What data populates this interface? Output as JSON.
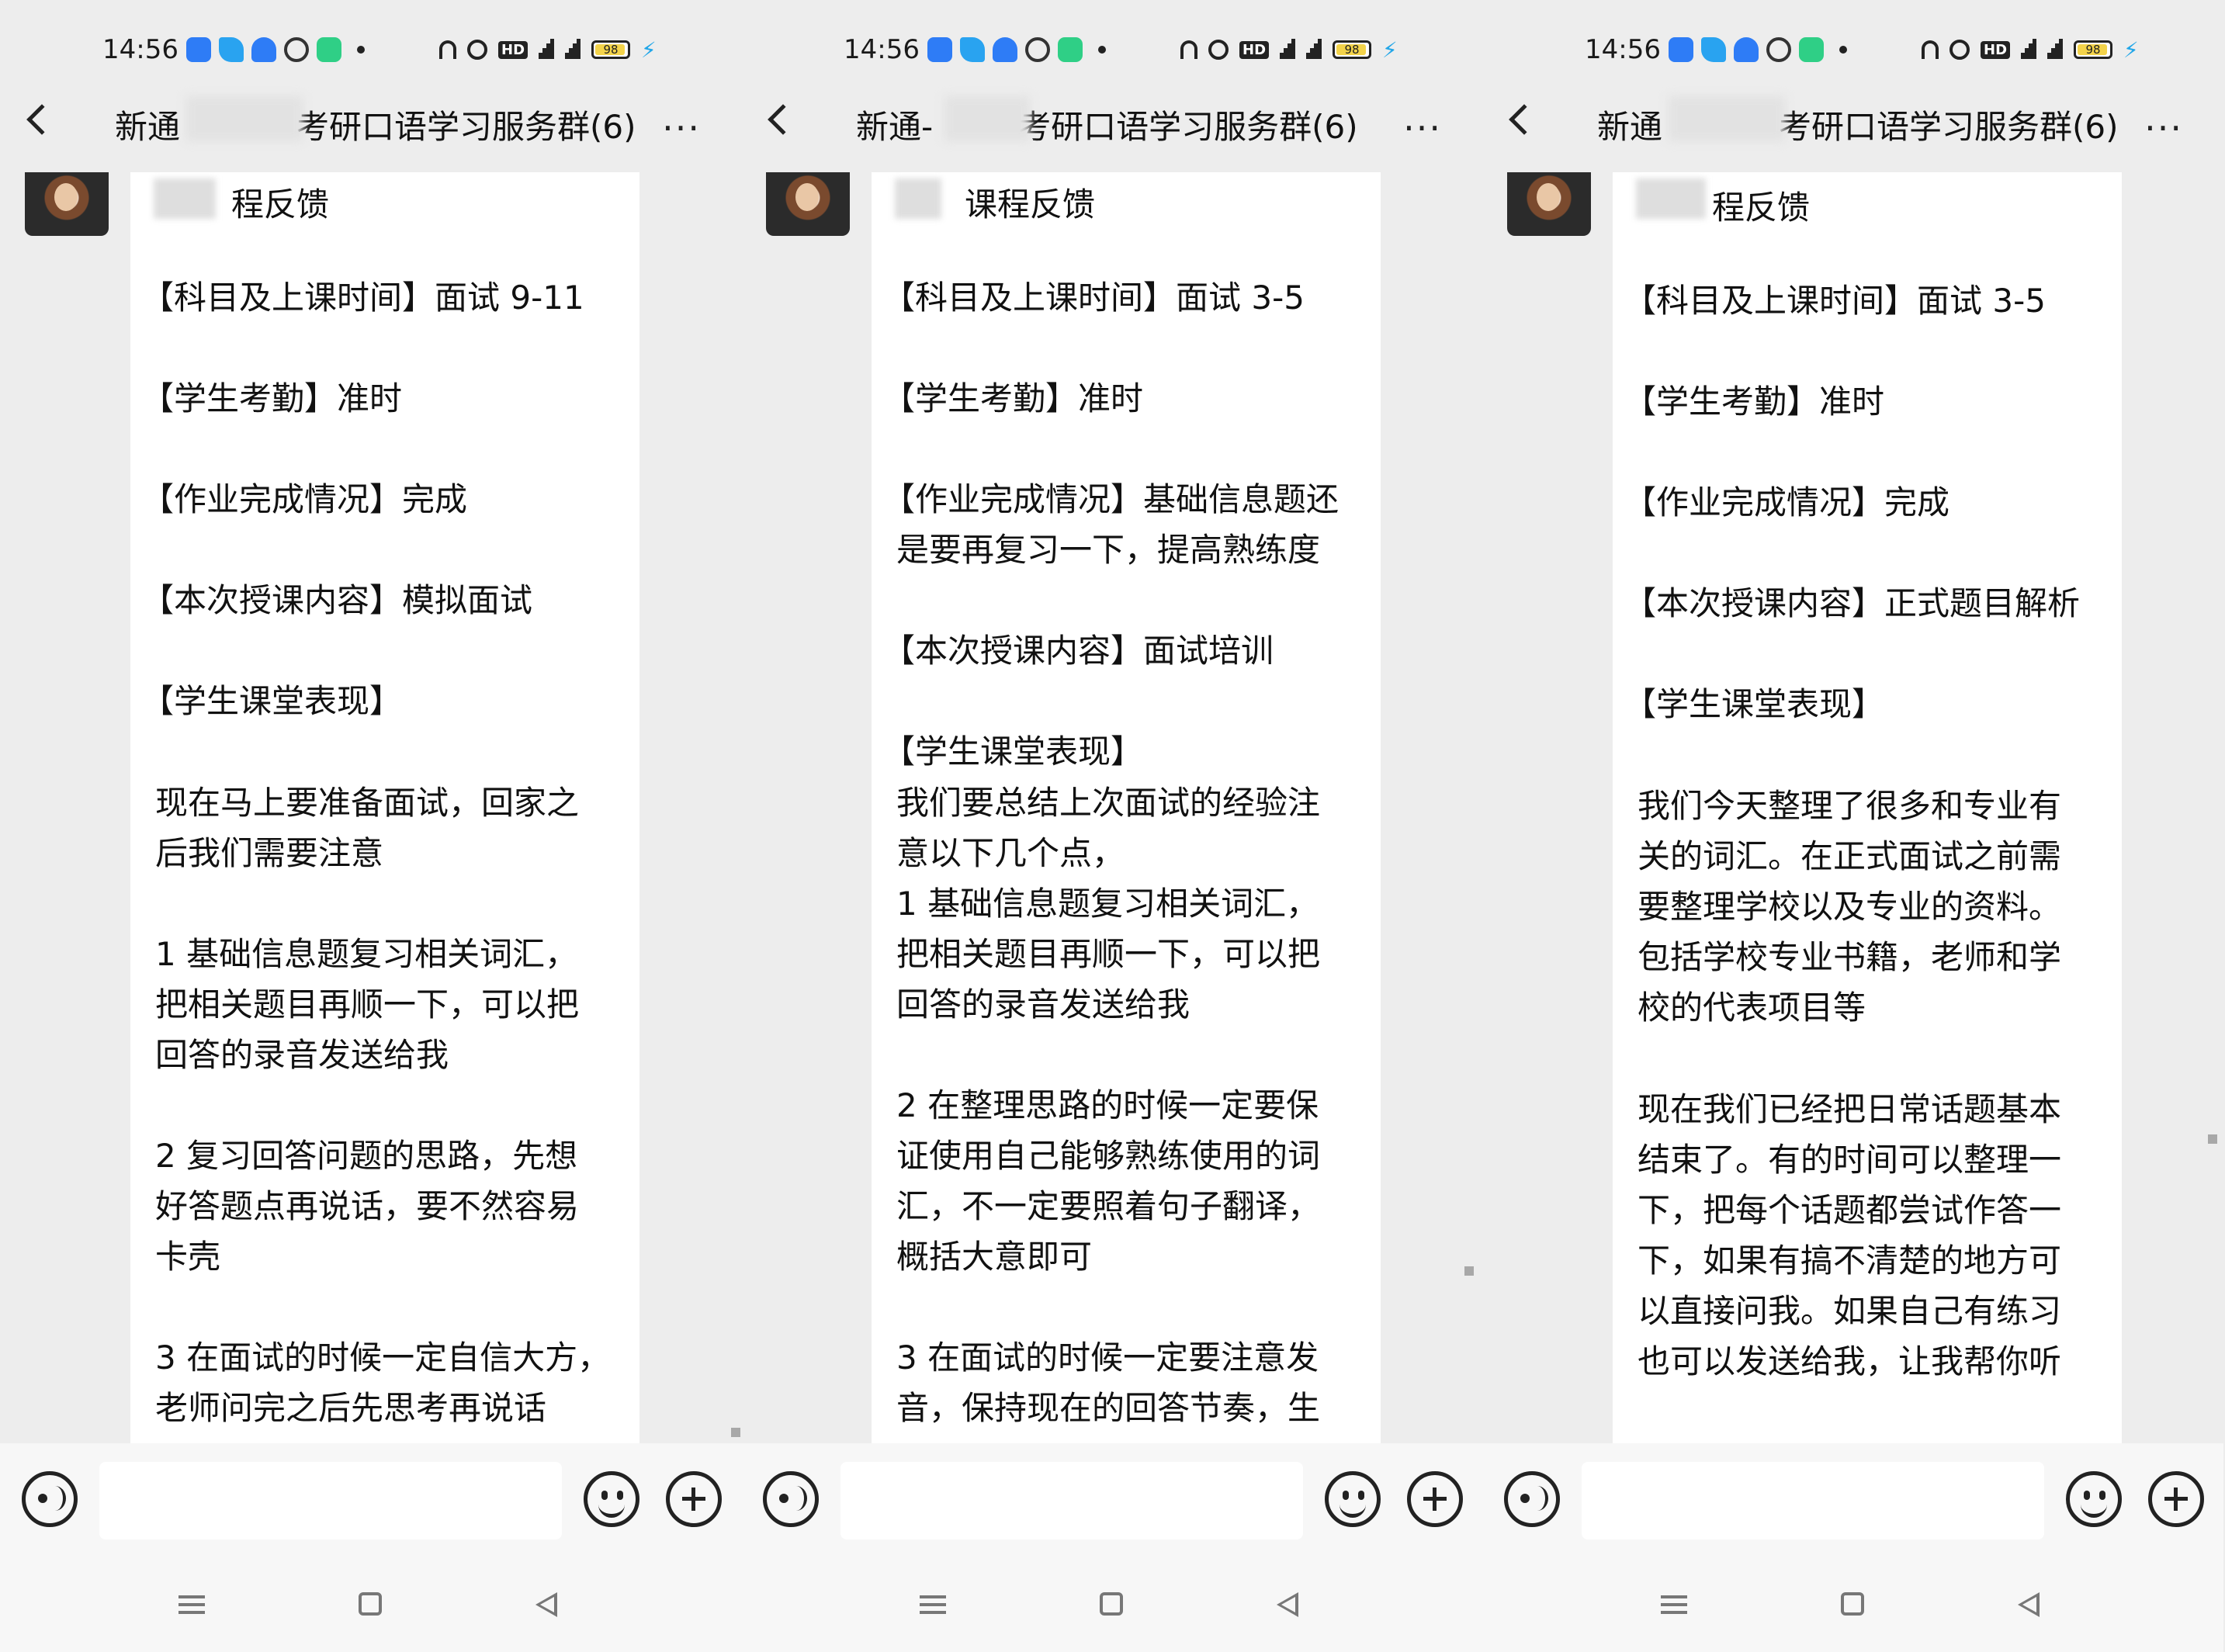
{
  "status_bar": {
    "time": "14:56",
    "battery": "98"
  },
  "panels": [
    {
      "title": "新通-王■■考研口语学习服务群(6)",
      "title_prefix": "新通",
      "title_suffix": "考研口语学习服务群(6)",
      "header": "程反馈",
      "lines": [
        "【科目及上课时间】面试 9-11",
        "【学生考勤】准时",
        "【作业完成情况】完成",
        "【本次授课内容】模拟面试",
        "【学生课堂表现】"
      ],
      "paragraphs": [
        "现在马上要准备面试，回家之\n后我们需要注意",
        "1 基础信息题复习相关词汇，\n把相关题目再顺一下，可以把\n回答的录音发送给我",
        "2 复习回答问题的思路，先想\n好答题点再说话，要不然容易\n卡壳",
        "3 在面试的时候一定自信大方，\n老师问完之后先思考再说话"
      ]
    },
    {
      "title": "新通-王■■考研口语学习服务群(6)",
      "title_prefix": "新通-",
      "title_suffix": "考研口语学习服务群(6)",
      "header": "课程反馈",
      "lines": [
        "【科目及上课时间】面试 3-5",
        "【学生考勤】准时",
        "【作业完成情况】基础信息题还",
        "是要再复习一下，提高熟练度",
        "【本次授课内容】面试培训",
        "【学生课堂表现】"
      ],
      "paragraphs": [
        "我们要总结上次面试的经验注\n意以下几个点，\n1 基础信息题复习相关词汇，\n把相关题目再顺一下，可以把\n回答的录音发送给我",
        "2 在整理思路的时候一定要保\n证使用自己能够熟练使用的词\n汇，不一定要照着句子翻译，\n概括大意即可",
        "3 在面试的时候一定要注意发\n音，保持现在的回答节奏，生"
      ]
    },
    {
      "title": "新通-王■■考研口语学习服务群(6)",
      "title_prefix": "新通",
      "title_suffix": "考研口语学习服务群(6)",
      "header": "程反馈",
      "lines": [
        "【科目及上课时间】面试 3-5",
        "【学生考勤】准时",
        "【作业完成情况】完成",
        "【本次授课内容】正式题目解析",
        "【学生课堂表现】"
      ],
      "paragraphs": [
        "我们今天整理了很多和专业有\n关的词汇。在正式面试之前需\n要整理学校以及专业的资料。\n包括学校专业书籍，老师和学\n校的代表项目等",
        "现在我们已经把日常话题基本\n结束了。有的时间可以整理一\n下，把每个话题都尝试作答一\n下，如果有搞不清楚的地方可\n以直接问我。如果自己有练习\n也可以发送给我，让我帮你听"
      ]
    }
  ]
}
